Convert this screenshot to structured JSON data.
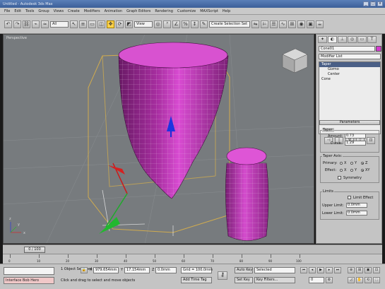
{
  "window": {
    "title": "Untitled - Autodesk 3ds Max",
    "min": "_",
    "max": "□",
    "close": "x"
  },
  "menu": [
    "File",
    "Edit",
    "Tools",
    "Group",
    "Views",
    "Create",
    "Modifiers",
    "Animation",
    "Graph Editors",
    "Rendering",
    "Customize",
    "MAXScript",
    "Help"
  ],
  "toolbar": {
    "icons": [
      "undo-icon",
      "redo-icon",
      "link-icon",
      "unlink-icon",
      "bind-space-warp-icon",
      "select-icon",
      "select-by-name-icon",
      "rect-selection-icon",
      "window-crossing-icon",
      "move-icon",
      "rotate-icon",
      "scale-icon",
      "snaps-icon",
      "angle-snap-icon",
      "percent-snap-icon",
      "mirror-icon",
      "align-icon",
      "layer-icon",
      "curve-editor-icon",
      "material-editor-icon",
      "render-icon"
    ],
    "filter": "All",
    "ref_coord": "View",
    "selection_set": "Create Selection Set"
  },
  "viewport": {
    "label": "Perspective",
    "axis_x": "x",
    "axis_y": "y",
    "axis_z": "z",
    "colors": {
      "object": "#b83bb0",
      "background": "#777b7e"
    }
  },
  "command_panel": {
    "tabs": [
      "create-tab",
      "modify-tab",
      "hierarchy-tab",
      "motion-tab",
      "display-tab",
      "utilities-tab"
    ],
    "object_name": "Cone01",
    "object_color": "#d63bd0",
    "modifier_list": "Modifier List",
    "stack": [
      "Taper",
      "Gizmo",
      "Center",
      "Cone"
    ],
    "stack_buttons": [
      "pin-stack-icon",
      "show-end-result-icon",
      "make-unique-icon",
      "remove-modifier-icon",
      "configure-sets-icon"
    ],
    "rollout": "Parameters",
    "taper_group": "Taper:",
    "amount_label": "Amount:",
    "amount_value": "0.73",
    "curve_label": "Curve:",
    "curve_value": "1.29",
    "axis_group": "Taper Axis:",
    "primary_label": "Primary:",
    "effect_label": "Effect:",
    "symmetry_label": "Symmetry",
    "limits_group": "Limits",
    "limit_effect_label": "Limit Effect",
    "upper_label": "Upper Limit:",
    "upper_value": "0.0mm",
    "lower_label": "Lower Limit:",
    "lower_value": "0.0mm",
    "radio_labels": {
      "x": "X",
      "y": "Y",
      "z": "Z",
      "xy": "XY"
    }
  },
  "timeline": {
    "slider": "0 / 100",
    "ticks": [
      "0",
      "10",
      "20",
      "30",
      "40",
      "50",
      "60",
      "70",
      "80",
      "90",
      "100"
    ]
  },
  "status": {
    "listener": "Interface Bob Hero",
    "selected_count": "1 Object Selected",
    "prompt": "Click and drag to select and move objects",
    "x_label": "X",
    "x_value": "979.654mm",
    "y_label": "Y",
    "y_value": "17.154mm",
    "z_label": "Z",
    "z_value": "0.0mm",
    "grid": "Grid = 100.0mm",
    "add_time_tag": "Add Time Tag",
    "autokey": "Auto Key",
    "setkey": "Set Key",
    "key_mode": "Selected",
    "key_filters": "Key Filters...",
    "frame": "0",
    "playback": [
      "go-start-icon",
      "prev-frame-icon",
      "play-icon",
      "next-frame-icon",
      "go-end-icon"
    ]
  }
}
